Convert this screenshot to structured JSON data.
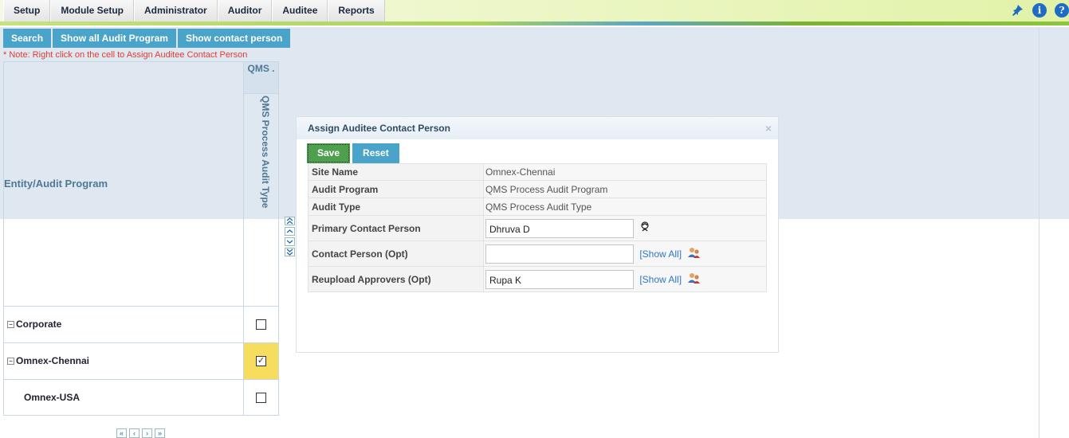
{
  "nav": {
    "tabs": [
      "Setup",
      "Module Setup",
      "Administrator",
      "Auditor",
      "Auditee",
      "Reports"
    ],
    "icons": [
      "pin-icon",
      "info-icon",
      "help-icon"
    ],
    "info_glyph": "i",
    "help_glyph": "?"
  },
  "toolbar": {
    "search": "Search",
    "show_all": "Show all Audit Program",
    "show_contact": "Show contact person"
  },
  "note": "* Note: Right click on the cell to Assign Auditee Contact Person",
  "grid": {
    "group_header": "QMS .",
    "column_header": "QMS Process Audit Type",
    "entity_header": "Entity/Audit Program",
    "rows": [
      {
        "label": "Corporate",
        "expandable": true,
        "checked": false,
        "selected": false
      },
      {
        "label": "Omnex-Chennai",
        "expandable": true,
        "checked": true,
        "selected": true
      },
      {
        "label": "Omnex-USA",
        "expandable": false,
        "checked": false,
        "selected": false
      }
    ],
    "expand_glyph": "−",
    "check_glyph": "✓"
  },
  "scroll_buttons": [
    "«",
    "‹",
    "›",
    "»"
  ],
  "pager": [
    "«",
    "‹",
    "›",
    "»"
  ],
  "dialog": {
    "title": "Assign Auditee Contact Person",
    "close": "×",
    "save_label": "Save",
    "reset_label": "Reset",
    "fields": {
      "site_name_label": "Site Name",
      "site_name_value": "Omnex-Chennai",
      "audit_program_label": "Audit Program",
      "audit_program_value": "QMS Process Audit Program",
      "audit_type_label": "Audit Type",
      "audit_type_value": "QMS Process Audit Type",
      "primary_contact_label": "Primary Contact Person",
      "primary_contact_value": "Dhruva D",
      "contact_person_label": "Contact Person (Opt)",
      "contact_person_value": "",
      "reupload_label": "Reupload Approvers (Opt)",
      "reupload_value": "Rupa K",
      "show_all": "[Show All]"
    }
  },
  "colors": {
    "button_blue": "#4aa3c9",
    "save_green": "#4ea04e",
    "note_red": "#e03c32",
    "selected_cell": "#f7dd5d"
  }
}
